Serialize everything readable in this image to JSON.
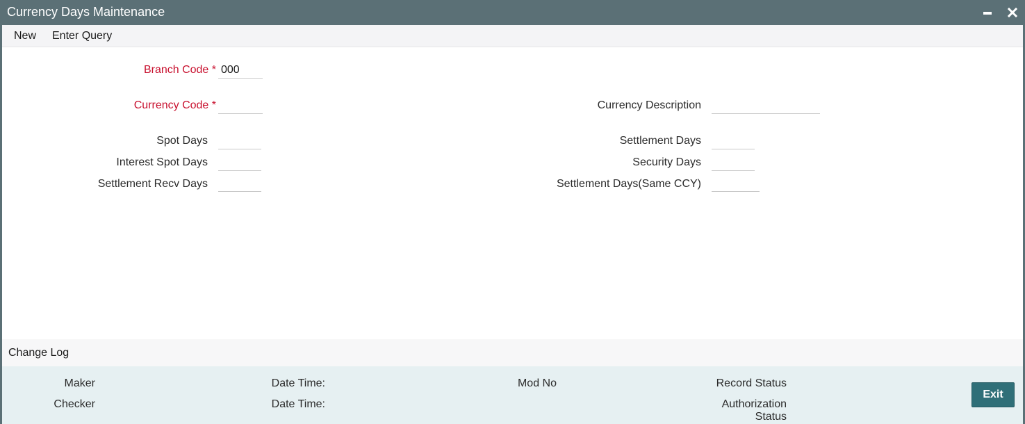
{
  "window": {
    "title": "Currency Days Maintenance"
  },
  "toolbar": {
    "new_label": "New",
    "enter_query_label": "Enter Query"
  },
  "form": {
    "branch_code": {
      "label": "Branch Code *",
      "value": "000"
    },
    "currency_code": {
      "label": "Currency Code *",
      "value": ""
    },
    "currency_description": {
      "label": "Currency Description",
      "value": ""
    },
    "spot_days": {
      "label": "Spot Days",
      "value": ""
    },
    "settlement_days": {
      "label": "Settlement Days",
      "value": ""
    },
    "interest_spot_days": {
      "label": "Interest Spot Days",
      "value": ""
    },
    "security_days": {
      "label": "Security Days",
      "value": ""
    },
    "settlement_recv_days": {
      "label": "Settlement Recv Days",
      "value": ""
    },
    "settlement_days_same_ccy": {
      "label": "Settlement Days(Same CCY)",
      "value": ""
    }
  },
  "change_log": {
    "title": "Change Log",
    "maker_label": "Maker",
    "checker_label": "Checker",
    "maker_date_time_label": "Date Time:",
    "checker_date_time_label": "Date Time:",
    "mod_no_label": "Mod No",
    "record_status_label": "Record Status",
    "authorization_status_label_line1": "Authorization",
    "authorization_status_label_line2": "Status"
  },
  "buttons": {
    "exit_label": "Exit"
  },
  "colors": {
    "titlebar": "#5b7076",
    "required_label": "#c8102e",
    "footer_bg": "#e6f0f2",
    "exit_button": "#2f6f78"
  },
  "icons": {
    "minimize": "minimize-icon",
    "close": "close-icon"
  }
}
